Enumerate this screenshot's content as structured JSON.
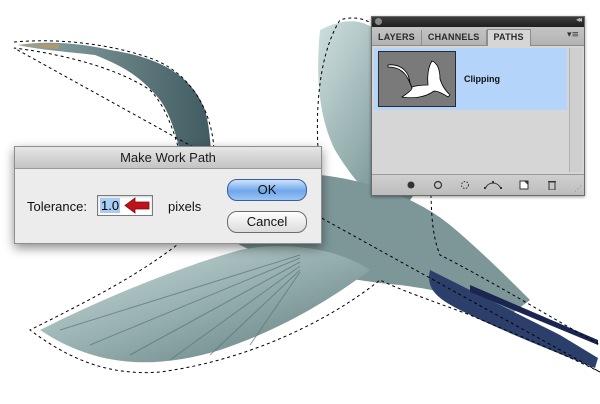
{
  "panel": {
    "tabs": [
      "LAYERS",
      "CHANNELS",
      "PATHS"
    ],
    "active_tab": "PATHS",
    "path_name": "Clipping",
    "footer_buttons": [
      "fill-path-icon",
      "stroke-path-icon",
      "load-selection-icon",
      "make-work-path-icon",
      "new-path-icon",
      "delete-path-icon"
    ]
  },
  "dialog": {
    "title": "Make Work Path",
    "tolerance_label": "Tolerance:",
    "tolerance_value": "1.0",
    "unit": "pixels",
    "ok_label": "OK",
    "cancel_label": "Cancel"
  },
  "colors": {
    "selection_highlight": "#b4d4fa",
    "ok_button": "#6ea6ea",
    "arrow": "#c0121a"
  }
}
